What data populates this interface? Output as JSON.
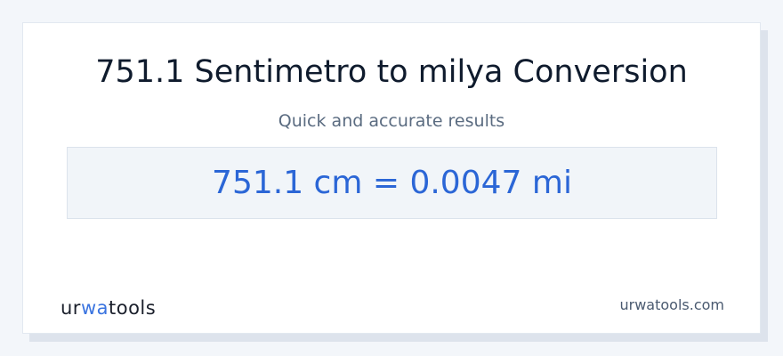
{
  "title": "751.1 Sentimetro to milya Conversion",
  "subtitle": "Quick and accurate results",
  "result": "751.1 cm = 0.0047 mi",
  "logo": {
    "prefix": "ur",
    "accent": "wa",
    "suffix": "tools"
  },
  "site": "urwatools.com",
  "colors": {
    "accent": "#2b66d6",
    "result_background": "#f1f5f9"
  }
}
